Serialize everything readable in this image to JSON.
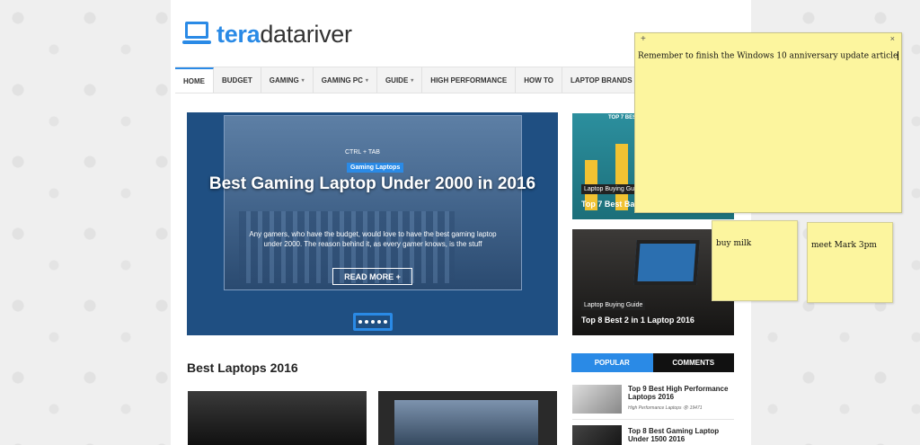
{
  "logo": {
    "part1": "tera",
    "part2": "datariver"
  },
  "nav": {
    "items": [
      {
        "label": "HOME",
        "active": true,
        "dropdown": false
      },
      {
        "label": "BUDGET",
        "dropdown": false
      },
      {
        "label": "GAMING",
        "dropdown": true
      },
      {
        "label": "GAMING PC",
        "dropdown": true
      },
      {
        "label": "GUIDE",
        "dropdown": true
      },
      {
        "label": "HIGH PERFORMANCE",
        "dropdown": false
      },
      {
        "label": "HOW TO",
        "dropdown": false
      },
      {
        "label": "LAPTOP BRANDS",
        "dropdown": true
      }
    ]
  },
  "hero": {
    "ctrl_text": "CTRL + TAB",
    "tag": "Gaming Laptops",
    "title": "Best Gaming Laptop Under 2000 in 2016",
    "excerpt": "Any gamers, who have the budget, would love to have the best gaming laptop under 2000. The reason behind it, as every gamer knows, is the stuff",
    "button": "READ MORE +"
  },
  "side_posts": [
    {
      "chart_title": "TOP 7 BEST",
      "tag": "Laptop Buying Guide",
      "title": "Top 7 Best Ba"
    },
    {
      "tag": "Laptop Buying Guide",
      "title": "Top 8 Best 2 in 1 Laptop 2016"
    }
  ],
  "section": {
    "title": "Best Laptops 2016"
  },
  "tabs": {
    "popular": "POPULAR",
    "comments": "COMMENTS"
  },
  "popular": [
    {
      "title": "Top 9 Best High Performance Laptops 2016",
      "category": "High Performance Laptops",
      "views": "19471"
    },
    {
      "title": "Top 8 Best Gaming Laptop Under 1500 2016"
    }
  ],
  "notes": {
    "big": {
      "plus": "+",
      "close": "×",
      "text": "Remember to finish the Windows 10 anniversary update article"
    },
    "small1": {
      "text": "buy milk"
    },
    "small2": {
      "text": "meet Mark 3pm"
    }
  },
  "colors": {
    "accent": "#2a8ae6",
    "note": "#fcf59e"
  }
}
